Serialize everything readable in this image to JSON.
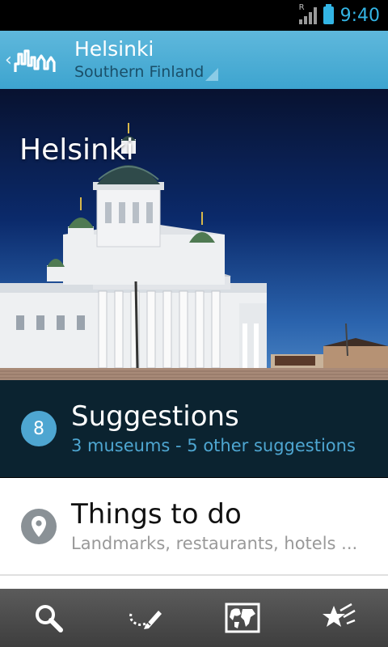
{
  "status": {
    "time": "9:40",
    "signal_label": "R"
  },
  "action_bar": {
    "title": "Helsinki",
    "subtitle": "Southern Finland"
  },
  "hero": {
    "title": "Helsinki"
  },
  "suggestions": {
    "count": "8",
    "title": "Suggestions",
    "subtitle": "3 museums - 5 other suggestions"
  },
  "things_to_do": {
    "title": "Things to do",
    "subtitle": "Landmarks, restaurants, hotels ..."
  },
  "bottom_bar": {
    "icons": [
      "search-icon",
      "draw-route-icon",
      "map-icon",
      "favorites-icon"
    ]
  },
  "colors": {
    "accent": "#33b5e5",
    "action_bar": "#4aaed6",
    "suggestions_bg": "#0b2330",
    "badge": "#4ea6d1"
  }
}
